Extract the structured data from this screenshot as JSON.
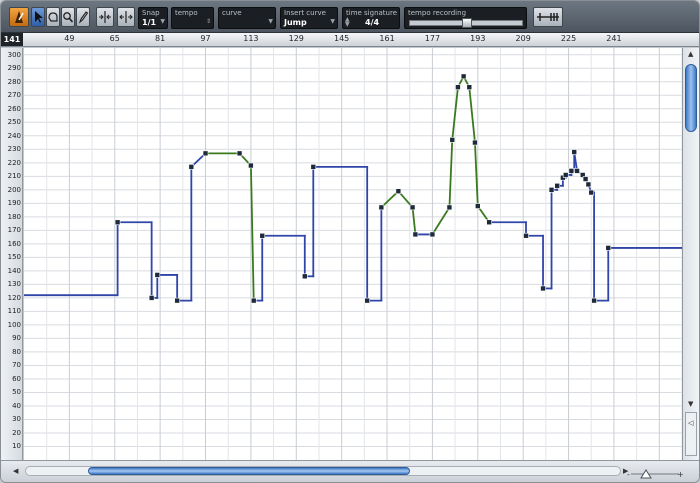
{
  "toolbar": {
    "tools": [
      "tempo-track-icon",
      "pointer-icon",
      "select-range-icon",
      "zoom-icon",
      "pencil-icon",
      "snap-to-grid-icon",
      "split-icon",
      "tempo-recording-toggle-icon"
    ],
    "snap": {
      "label": "Snap",
      "value": "1/1"
    },
    "tempo": {
      "label": "tempo",
      "value": ""
    },
    "curve": {
      "label": "curve",
      "value": ""
    },
    "insert_curve": {
      "label": "Insert curve",
      "value": "Jump"
    },
    "time_signature": {
      "label": "time signature",
      "value": "4/4"
    },
    "tempo_recording": {
      "label": "tempo recording"
    }
  },
  "ruler": {
    "position": "141",
    "labels": [
      "49",
      "65",
      "81",
      "97",
      "113",
      "129",
      "145",
      "161",
      "177",
      "193",
      "209",
      "225",
      "241"
    ]
  },
  "scale": {
    "labels": [
      "300",
      "290",
      "280",
      "270",
      "260",
      "250",
      "240",
      "230",
      "220",
      "210",
      "200",
      "190",
      "180",
      "170",
      "160",
      "150",
      "140",
      "130",
      "120",
      "110",
      "100",
      "90",
      "80",
      "70",
      "60",
      "50",
      "40",
      "30",
      "20",
      "10"
    ]
  },
  "colors": {
    "jump_curve": "#2f45a8",
    "ramp_curve": "#3a7a1e",
    "grid": "#d8dbe0",
    "point": "#1e2a3a"
  },
  "chart_data": {
    "type": "line",
    "title": "",
    "xlabel": "",
    "ylabel": "",
    "xlim": [
      33,
      265
    ],
    "ylim": [
      0,
      305
    ],
    "series": [
      {
        "name": "",
        "points": [
          [
            33,
            122,
            "j"
          ],
          [
            66,
            122,
            "j"
          ],
          [
            66,
            176,
            "j"
          ],
          [
            78,
            176,
            "j"
          ],
          [
            78,
            120,
            "j"
          ],
          [
            80,
            120,
            "j"
          ],
          [
            80,
            137,
            "j"
          ],
          [
            87,
            137,
            "j"
          ],
          [
            87,
            118,
            "j"
          ],
          [
            92,
            118,
            "j"
          ],
          [
            92,
            217,
            "j"
          ],
          [
            97,
            227,
            "r"
          ],
          [
            109,
            227,
            "r"
          ],
          [
            113,
            218,
            "r"
          ],
          [
            114,
            118,
            "j"
          ],
          [
            117,
            118,
            "j"
          ],
          [
            117,
            166,
            "j"
          ],
          [
            132,
            166,
            "j"
          ],
          [
            132,
            136,
            "j"
          ],
          [
            135,
            136,
            "j"
          ],
          [
            135,
            217,
            "j"
          ],
          [
            154,
            217,
            "j"
          ],
          [
            154,
            118,
            "j"
          ],
          [
            159,
            118,
            "j"
          ],
          [
            159,
            187,
            "r"
          ],
          [
            165,
            199,
            "r"
          ],
          [
            170,
            187,
            "r"
          ],
          [
            171,
            167,
            "j"
          ],
          [
            177,
            167,
            "j"
          ],
          [
            177,
            167,
            "r"
          ],
          [
            183,
            187,
            "r"
          ],
          [
            184,
            237,
            "r"
          ],
          [
            186,
            276,
            "r"
          ],
          [
            188,
            284,
            "r"
          ],
          [
            190,
            276,
            "r"
          ],
          [
            192,
            235,
            "r"
          ],
          [
            193,
            188,
            "r"
          ],
          [
            197,
            176,
            "j"
          ],
          [
            210,
            176,
            "j"
          ],
          [
            210,
            166,
            "j"
          ],
          [
            216,
            166,
            "j"
          ],
          [
            216,
            127,
            "j"
          ],
          [
            219,
            127,
            "j"
          ],
          [
            219,
            200,
            "j"
          ],
          [
            221,
            200,
            "j"
          ],
          [
            221,
            203,
            "j"
          ],
          [
            223,
            203,
            "j"
          ],
          [
            223,
            209,
            "j"
          ],
          [
            224,
            209,
            "j"
          ],
          [
            224,
            211,
            "j"
          ],
          [
            226,
            211,
            "j"
          ],
          [
            226,
            214,
            "j"
          ],
          [
            227,
            214,
            "j"
          ],
          [
            227,
            228,
            "j"
          ],
          [
            228,
            214,
            "j"
          ],
          [
            230,
            211,
            "j"
          ],
          [
            231,
            208,
            "j"
          ],
          [
            232,
            204,
            "j"
          ],
          [
            233,
            198,
            "j"
          ],
          [
            234,
            198,
            "j"
          ],
          [
            234,
            118,
            "j"
          ],
          [
            239,
            118,
            "j"
          ],
          [
            239,
            157,
            "j"
          ],
          [
            265,
            157,
            "j"
          ]
        ]
      }
    ]
  }
}
